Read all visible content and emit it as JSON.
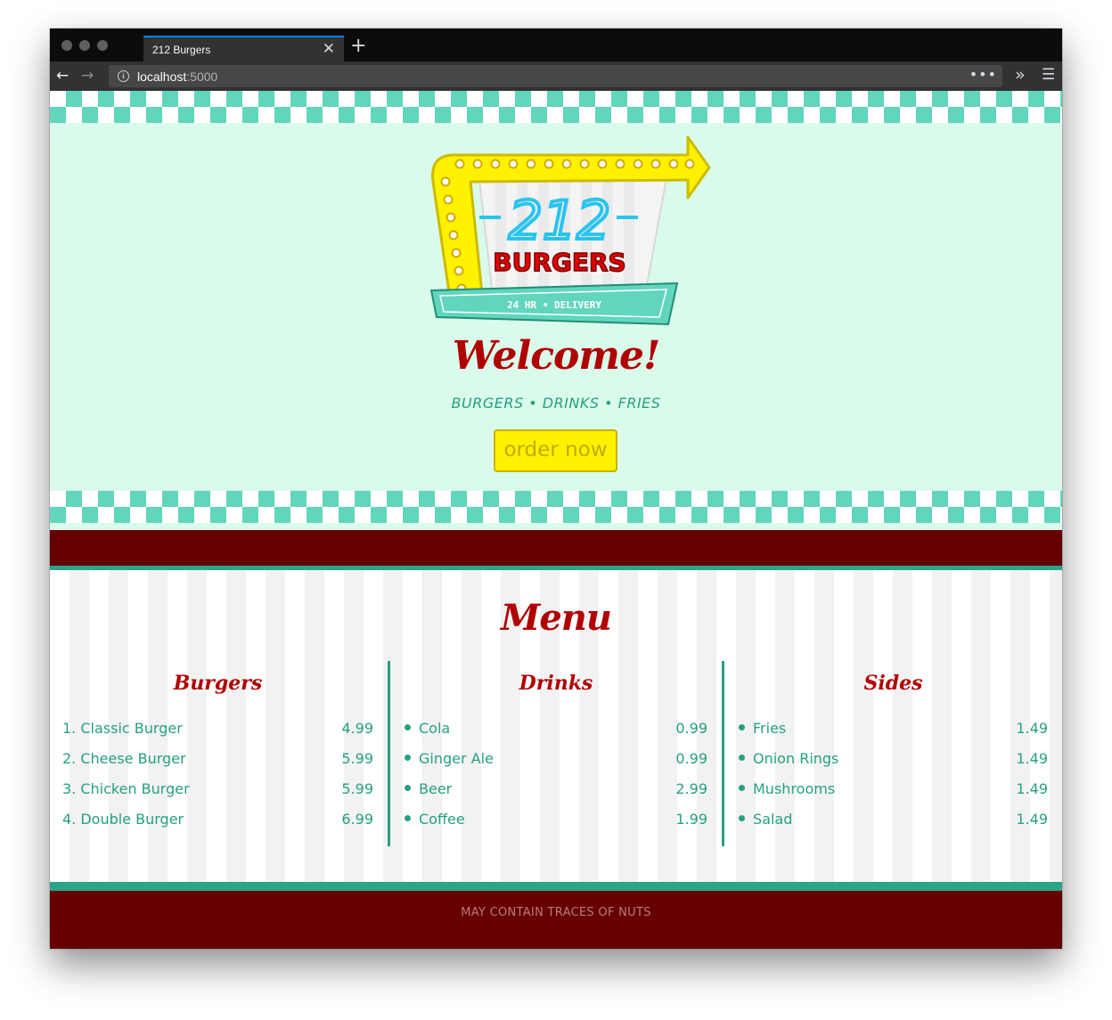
{
  "browser": {
    "tab_title": "212 Burgers",
    "url_host": "localhost",
    "url_port": ":5000"
  },
  "logo": {
    "number": "212",
    "word": "BURGERS",
    "strip": "24 HR • DELIVERY"
  },
  "hero": {
    "welcome": "Welcome!",
    "tagline": "BURGERS • DRINKS • FRIES",
    "order_button": "order now"
  },
  "menu": {
    "title": "Menu",
    "columns": [
      {
        "heading": "Burgers",
        "items": [
          {
            "name": "1. Classic Burger",
            "price": "4.99"
          },
          {
            "name": "2. Cheese Burger",
            "price": "5.99"
          },
          {
            "name": "3. Chicken Burger",
            "price": "5.99"
          },
          {
            "name": "4. Double Burger",
            "price": "6.99"
          }
        ]
      },
      {
        "heading": "Drinks",
        "items": [
          {
            "name": "Cola",
            "price": "0.99"
          },
          {
            "name": "Ginger Ale",
            "price": "0.99"
          },
          {
            "name": "Beer",
            "price": "2.99"
          },
          {
            "name": "Coffee",
            "price": "1.99"
          }
        ]
      },
      {
        "heading": "Sides",
        "items": [
          {
            "name": "Fries",
            "price": "1.49"
          },
          {
            "name": "Onion Rings",
            "price": "1.49"
          },
          {
            "name": "Mushrooms",
            "price": "1.49"
          },
          {
            "name": "Salad",
            "price": "1.49"
          }
        ]
      }
    ]
  },
  "footer": {
    "text": "MAY CONTAIN TRACES OF NUTS"
  },
  "colors": {
    "maroon": "#660000",
    "teal": "#2aa588",
    "mint": "#dafbec",
    "red": "#b00000",
    "yellow": "#fff200"
  }
}
